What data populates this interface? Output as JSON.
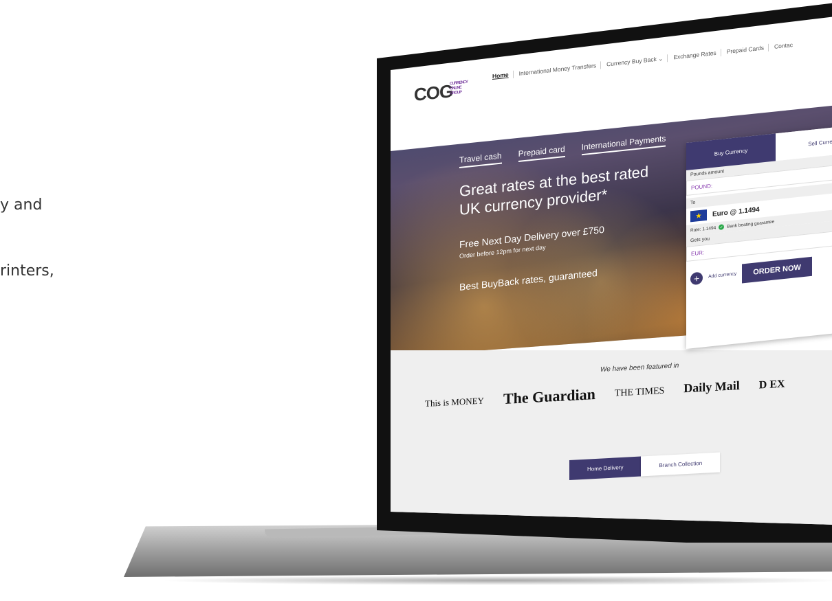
{
  "background_text": [
    "y and",
    "rinters,"
  ],
  "site": {
    "logo": {
      "text": "COG",
      "subtext": "CURRENCY ONLINE GROUP"
    },
    "nav": [
      "Home",
      "International Money Transfers",
      "Currency Buy Back ⌄",
      "Exchange Rates",
      "Prepaid Cards",
      "Contac"
    ],
    "hero": {
      "tabs": [
        "Travel cash",
        "Prepaid card",
        "International Payments"
      ],
      "headline": "Great rates at the best rated UK currency provider*",
      "delivery": "Free Next Day Delivery over £750",
      "order_note": "Order before 12pm for next day",
      "buyback": "Best BuyBack rates, guaranteed"
    },
    "widget": {
      "tab_buy": "Buy Currency",
      "tab_sell": "Sell Curre",
      "pounds_label": "Pounds amount",
      "pounds_value": "POUND:",
      "to_label": "To",
      "currency": "Euro @ 1.1494",
      "rate_text": "Rate: 1.1494",
      "guarantee": "Bank beating guarantee",
      "gets_label": "Gets you",
      "gets_value": "EUR:",
      "add_label": "Add currency",
      "order_button": "ORDER NOW"
    },
    "featured": {
      "title": "We have been featured in",
      "logos": [
        "This is MONEY",
        "The Guardian",
        "THE TIMES",
        "Daily Mail",
        "D EX"
      ]
    },
    "delivery_tabs": [
      "Home Delivery",
      "Branch Collection"
    ]
  },
  "colors": {
    "brand": "#3f3a70",
    "accent": "#8a3fb0"
  }
}
